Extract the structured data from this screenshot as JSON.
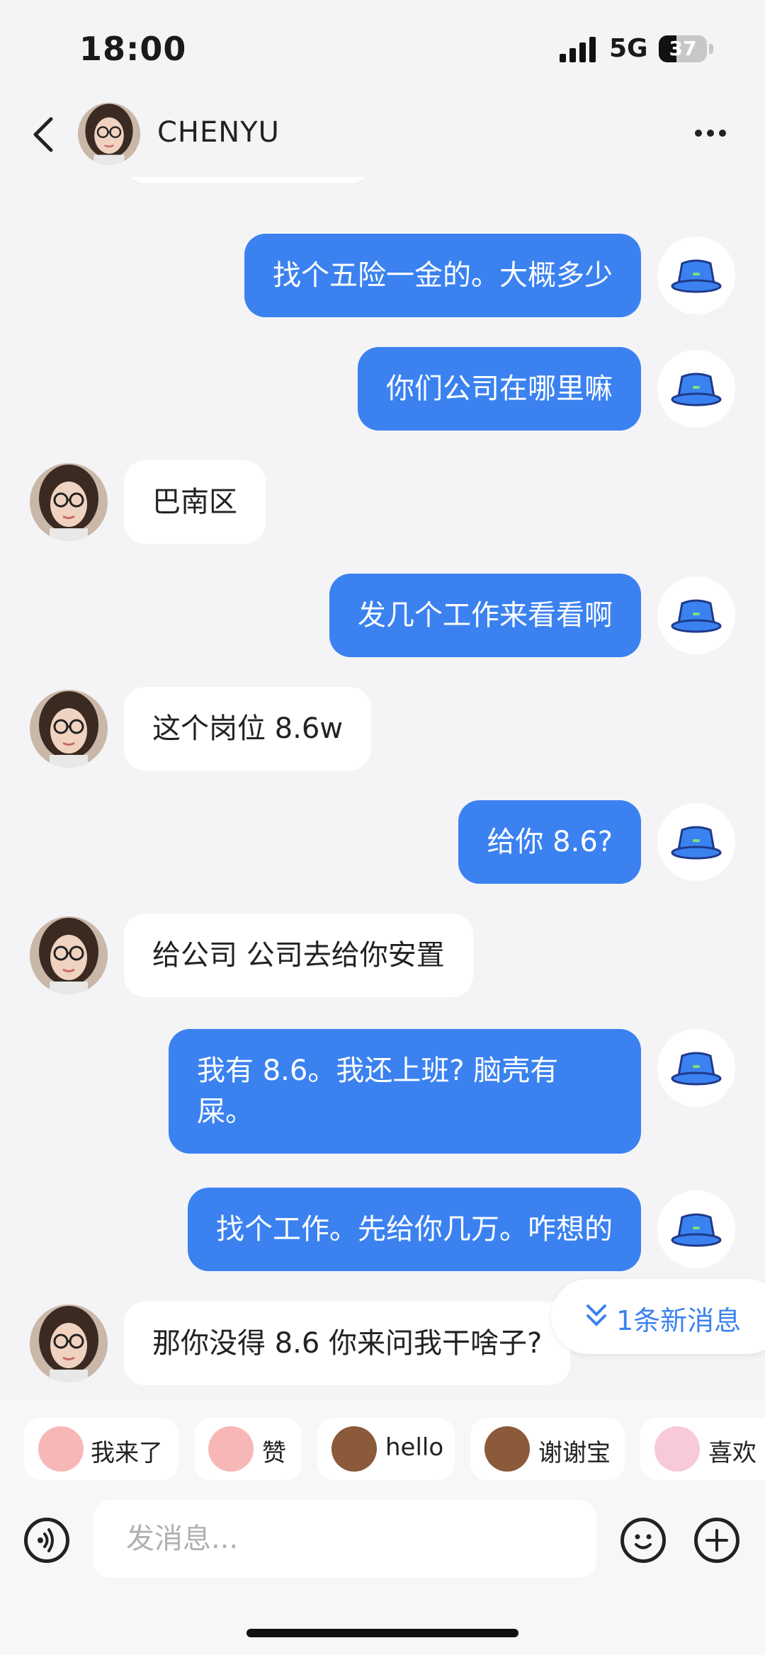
{
  "status": {
    "time": "18:00",
    "network": "5G",
    "battery": "37",
    "battery_level": 0.37
  },
  "header": {
    "contact_name": "CHENYU",
    "back_icon": "chevron-left-icon",
    "more_icon": "more-horizontal-icon"
  },
  "messages": [
    {
      "from": "me",
      "text": "找个五险一金的。大概多少"
    },
    {
      "from": "me",
      "text": "你们公司在哪里嘛"
    },
    {
      "from": "other",
      "text": "巴南区"
    },
    {
      "from": "me",
      "text": "发几个工作来看看啊"
    },
    {
      "from": "other",
      "text": "这个岗位 8.6w"
    },
    {
      "from": "me",
      "text": "给你 8.6?"
    },
    {
      "from": "other",
      "text": "给公司 公司去给你安置"
    },
    {
      "from": "me",
      "text": "我有 8.6。我还上班? 脑壳有\n屎。"
    },
    {
      "from": "me",
      "text": "找个工作。先给你几万。咋想的"
    },
    {
      "from": "other",
      "text": "那你没得 8.6 你来问我干啥子?"
    }
  ],
  "new_messages": {
    "label": "1条新消息",
    "icon": "double-chevron-down-icon"
  },
  "quick_stickers": [
    {
      "label": "我来了",
      "icon": "pig-sticker-icon"
    },
    {
      "label": "赞",
      "icon": "pig-sticker-icon"
    },
    {
      "label": "hello",
      "icon": "monkey-sticker-icon"
    },
    {
      "label": "谢谢宝",
      "icon": "monkey-sticker-icon"
    },
    {
      "label": "喜欢",
      "icon": "pig-sticker-icon"
    }
  ],
  "composer": {
    "placeholder": "发消息...",
    "voice_icon": "voice-icon",
    "emoji_icon": "emoji-icon",
    "plus_icon": "plus-icon"
  },
  "colors": {
    "accent": "#3b82f0",
    "background": "#f4f4f6"
  }
}
